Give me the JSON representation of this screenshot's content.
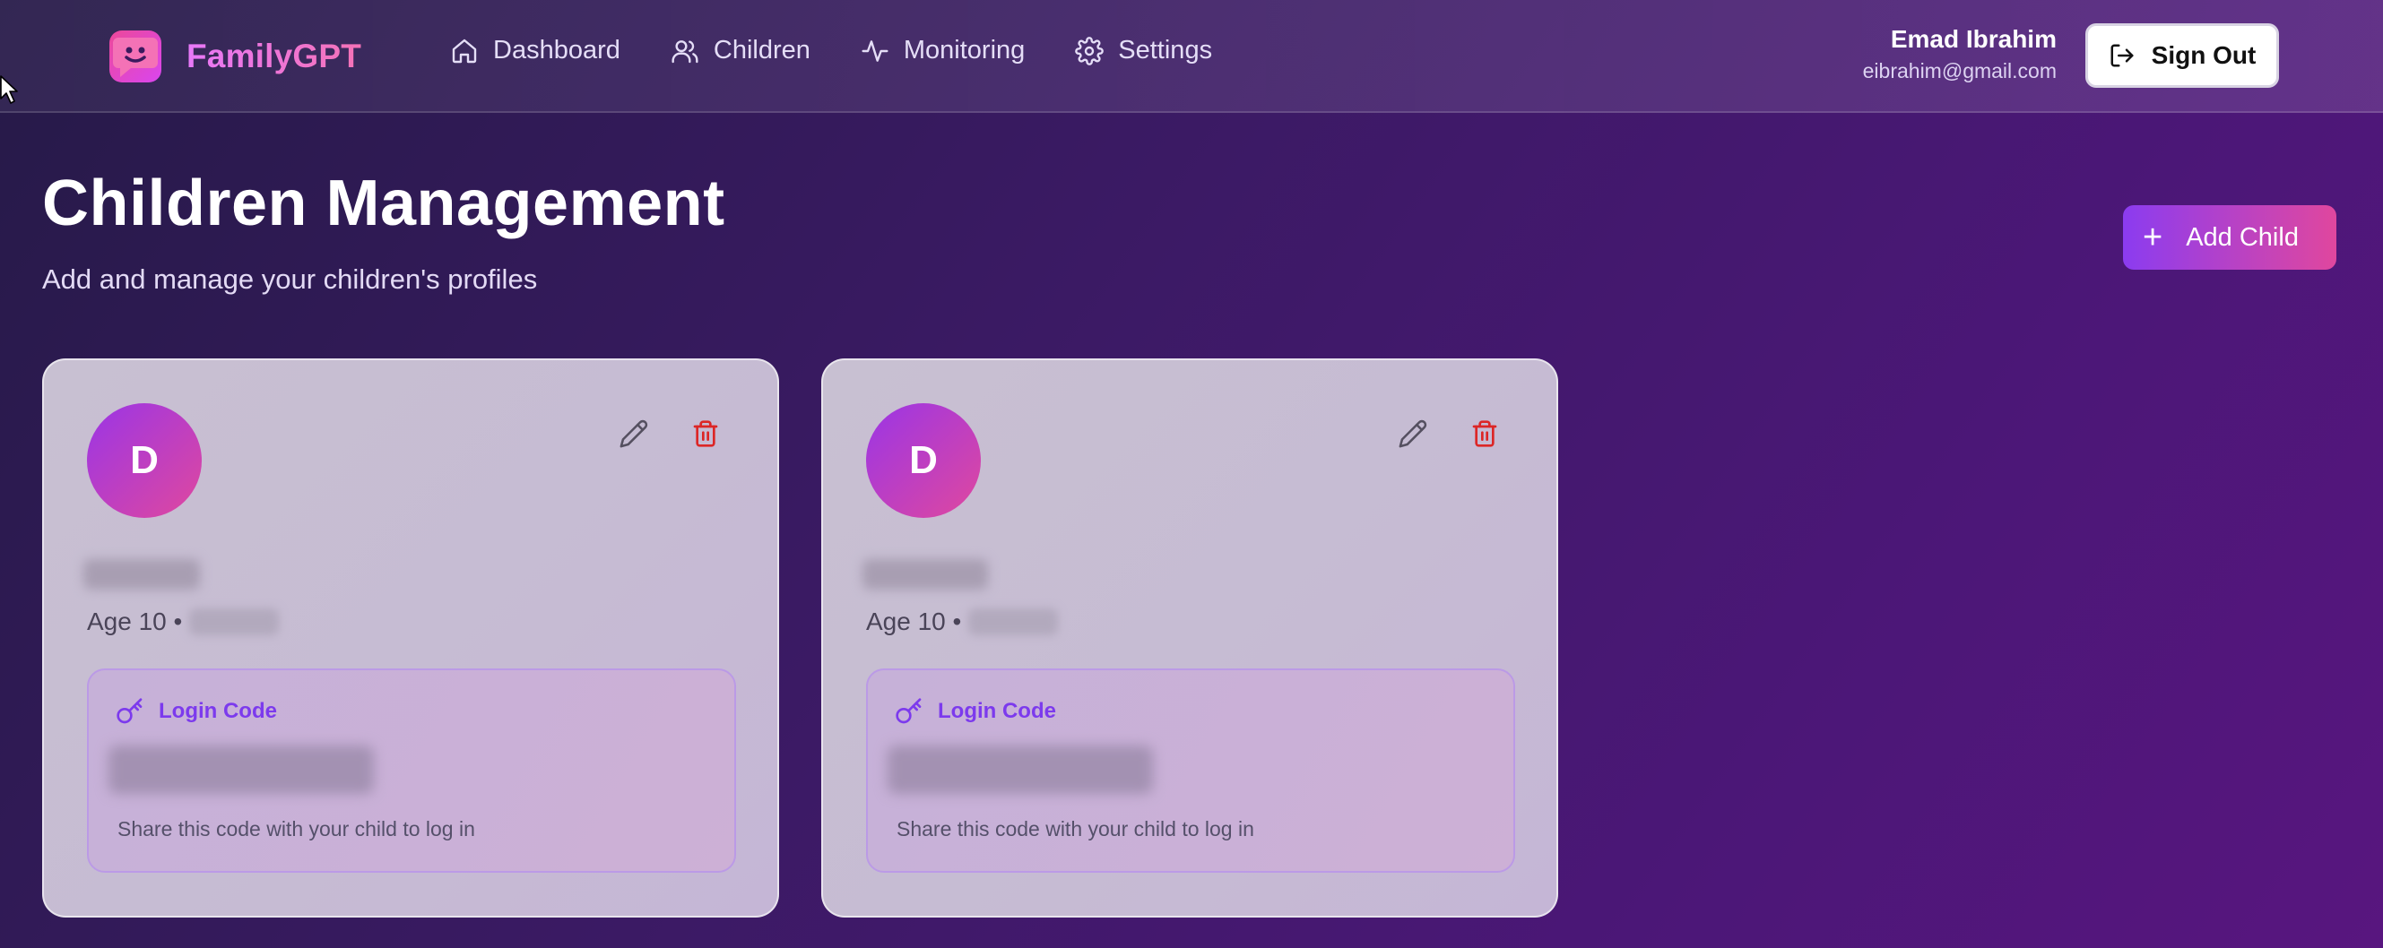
{
  "app": {
    "name": "FamilyGPT"
  },
  "nav": {
    "items": [
      {
        "label": "Dashboard",
        "icon": "home-icon"
      },
      {
        "label": "Children",
        "icon": "users-icon"
      },
      {
        "label": "Monitoring",
        "icon": "activity-icon"
      },
      {
        "label": "Settings",
        "icon": "gear-icon"
      }
    ]
  },
  "user": {
    "name": "Emad Ibrahim",
    "email": "eibrahim@gmail.com",
    "sign_out_label": "Sign Out"
  },
  "page": {
    "title": "Children Management",
    "subtitle": "Add and manage your children's profiles",
    "add_child_label": "Add Child"
  },
  "children": [
    {
      "initial": "D",
      "age_text": "Age 10 •",
      "login_code_label": "Login Code",
      "login_hint": "Share this code with your child to log in"
    },
    {
      "initial": "D",
      "age_text": "Age 10 •",
      "login_code_label": "Login Code",
      "login_hint": "Share this code with your child to log in"
    }
  ],
  "colors": {
    "accent_purple": "#7c3aed",
    "accent_pink": "#ec4899",
    "delete_red": "#dc2626"
  }
}
